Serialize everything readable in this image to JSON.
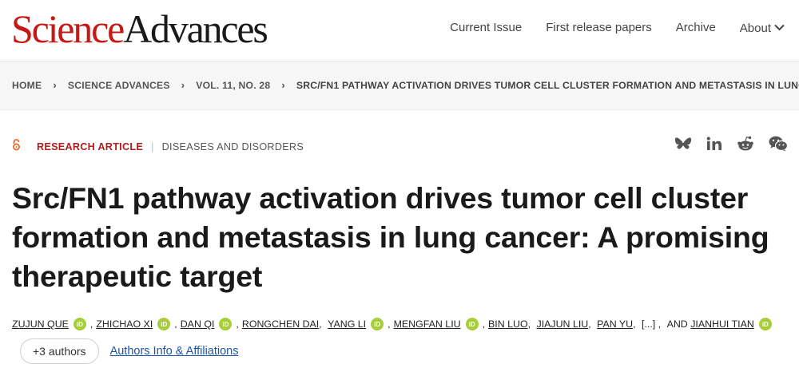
{
  "header": {
    "logo_part1": "Science",
    "logo_part2": "Advances",
    "nav": [
      "Current Issue",
      "First release papers",
      "Archive",
      "About"
    ]
  },
  "breadcrumb": [
    "HOME",
    "SCIENCE ADVANCES",
    "VOL. 11, NO. 28",
    "SRC/FN1 PATHWAY ACTIVATION DRIVES TUMOR CELL CLUSTER FORMATION AND METASTASIS IN LUNG..."
  ],
  "article": {
    "type": "RESEARCH ARTICLE",
    "subject": "DISEASES AND DISORDERS",
    "title": "Src/FN1 pathway activation drives tumor cell cluster formation and metastasis in lung cancer: A promising therapeutic target",
    "share_icons": [
      "bluesky-icon",
      "linkedin-icon",
      "reddit-icon",
      "wechat-icon"
    ]
  },
  "authors": {
    "a1": "ZUJUN QUE",
    "a2": "ZHICHAO XI",
    "a3": "DAN QI",
    "a4": "RONGCHEN DAI",
    "a5": "YANG LI",
    "a6": "MENGFAN LIU",
    "a7": "BIN LUO",
    "a8": "JIAJUN LIU",
    "a9": "PAN YU",
    "ellipsis": "[...]",
    "and": "AND",
    "a10": "JIANHUI TIAN",
    "orcid_label": "iD",
    "more_button": "+3 authors",
    "affiliations_link": "Authors Info & Affiliations"
  },
  "colors": {
    "brand_red": "#c41a16",
    "orcid_green": "#a6ce39",
    "link_blue": "#1d56a8",
    "oa_orange": "#e76a2b"
  }
}
